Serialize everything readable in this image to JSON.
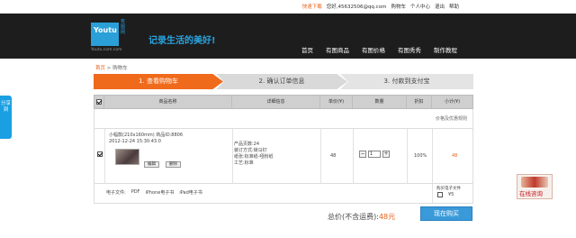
{
  "topbar": {
    "fast_download": "快速下载",
    "welcome": "您好,45632506@qq.com",
    "cart": "购物车",
    "user_center": "个人中心",
    "logout": "退出",
    "help": "帮助"
  },
  "header": {
    "logo_text": "Youtu",
    "logo_side": "有图网",
    "logo_url": "Youtu.com.com",
    "slogan": "记录生活的美好!",
    "nav": [
      "首页",
      "有图商品",
      "有图价格",
      "有图秀秀",
      "制作教程"
    ]
  },
  "breadcrumb": {
    "home": "首页",
    "sep": " > ",
    "current": "购物车"
  },
  "steps": [
    "1. 查看购物车",
    "2. 确认订单信息",
    "3. 付款到支付宝"
  ],
  "table": {
    "headers": [
      "商品名称",
      "详细信息",
      "单价(¥)",
      "数量",
      "折扣",
      "小计(¥)"
    ],
    "promo_link": "价格及优惠规则",
    "item": {
      "name": "小幅款(210x160mm) 商品ID:8806",
      "time": "2012-12-24 15:30:43.0",
      "edit_label": "编辑",
      "delete_label": "删除",
      "details": [
        "产品页数:24",
        "装订方式:锁马钉",
        "纸张:标准纸-哑粉纸",
        "工艺:标准"
      ],
      "price": "48",
      "quantity": "1",
      "discount": "100%",
      "subtotal": "48"
    },
    "options": {
      "label": "电子文件:",
      "formats": [
        "PDF",
        "iPhone电子书",
        "iPad电子书"
      ],
      "buy_ebook": "购买电子文件",
      "ebook_price": "¥5"
    }
  },
  "summary": {
    "label": "总价(不含运费):",
    "amount": "48元",
    "checkout": "现在购买"
  },
  "share_tab": "分享到",
  "consult": "在线咨询",
  "colors": {
    "accent_orange": "#f06a1b",
    "accent_blue": "#2a9fd8",
    "header_bg": "#1d1d1d"
  }
}
